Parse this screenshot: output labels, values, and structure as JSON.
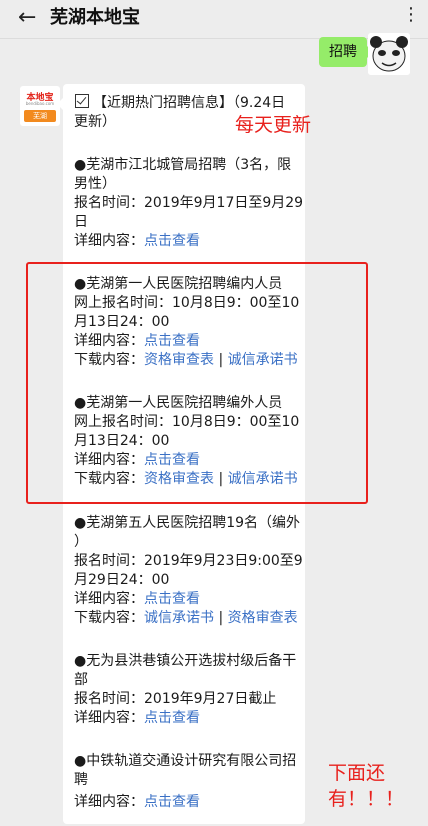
{
  "header": {
    "back_icon": "←",
    "title": "芜湖本地宝",
    "more_icon": "⋮"
  },
  "chat_right": {
    "text": "招聘"
  },
  "avatar_bot": {
    "name": "本地宝",
    "sub": "bendibao.com",
    "city": "芜湖"
  },
  "message": {
    "title_line1": "【近期热门招聘信息】（9.24日",
    "title_line2": "更新）",
    "items": [
      {
        "t1": "●芜湖市江北城管局招聘（3名，限",
        "t2": "男性）",
        "t3": "报名时间：2019年9月17日至9月29",
        "t4": "日",
        "detail_label": "详细内容：",
        "detail_link": "点击查看"
      },
      {
        "t1": "●芜湖第一人民医院招聘编内人员",
        "t2": "网上报名时间：10月8日9：00至10",
        "t3": "月13日24：00",
        "detail_label": "详细内容：",
        "detail_link": "点击查看",
        "download_label": "下载内容：",
        "download_link1": "资格审查表",
        "download_sep": " | ",
        "download_link2": "诚信承诺书"
      },
      {
        "t1": "●芜湖第一人民医院招聘编外人员",
        "t2": "网上报名时间：10月8日9：00至10",
        "t3": "月13日24：00",
        "detail_label": "详细内容：",
        "detail_link": "点击查看",
        "download_label": "下载内容：",
        "download_link1": "资格审查表",
        "download_sep": " | ",
        "download_link2": "诚信承诺书"
      },
      {
        "t1": "●芜湖第五人民医院招聘19名（编外",
        "t2": "）",
        "t3": "报名时间：2019年9月23日9:00至9",
        "t4": "月29日24：00",
        "detail_label": "详细内容：",
        "detail_link": "点击查看",
        "download_label": "下载内容：",
        "download_link1": "诚信承诺书",
        "download_sep": " | ",
        "download_link2": "资格审查表"
      },
      {
        "t1": "●无为县洪巷镇公开选拔村级后备干",
        "t2": "部",
        "t3": "报名时间：2019年9月27日截止",
        "detail_label": "详细内容：",
        "detail_link": "点击查看"
      },
      {
        "t1": "●中铁轨道交通设计研究有限公司招",
        "t2": "聘",
        "detail_label": "详细内容：",
        "detail_link": "点击查看"
      }
    ]
  },
  "annotations": {
    "daily": "每天更新",
    "more_line1": "下面还",
    "more_line2": "有！！！",
    "accent_color": "#e8211d"
  }
}
